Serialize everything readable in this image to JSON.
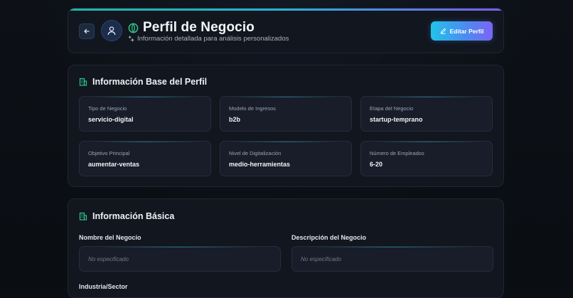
{
  "header": {
    "title": "Perfil de Negocio",
    "subtitle": "Información detallada para análisis personalizados",
    "edit_label": "Editar Perfil",
    "icons": {
      "back": "arrow-left-icon",
      "avatar": "user-icon",
      "title": "leaf-icon",
      "subtitle": "sparkle-icon",
      "edit": "pencil-icon"
    }
  },
  "base_profile": {
    "title": "Información Base del Perfil",
    "fields": [
      {
        "label": "Tipo de Negocio",
        "value": "servicio-digital"
      },
      {
        "label": "Modelo de Ingresos",
        "value": "b2b"
      },
      {
        "label": "Etapa del Negocio",
        "value": "startup-temprano"
      },
      {
        "label": "Objetivo Principal",
        "value": "aumentar-ventas"
      },
      {
        "label": "Nivel de Digitalización",
        "value": "medio-herramientas"
      },
      {
        "label": "Número de Empleados",
        "value": "6-20"
      }
    ]
  },
  "basic_info": {
    "title": "Información Básica",
    "fields": [
      {
        "label": "Nombre del Negocio",
        "value": "No especificado"
      },
      {
        "label": "Descripción del Negocio",
        "value": "No especificado"
      }
    ],
    "next_label": "Industria/Sector"
  },
  "colors": {
    "accent_teal": "#1fb6a6",
    "accent_blue": "#4a8df0",
    "accent_purple": "#7b64f3",
    "icon_green": "#2fc48d"
  }
}
